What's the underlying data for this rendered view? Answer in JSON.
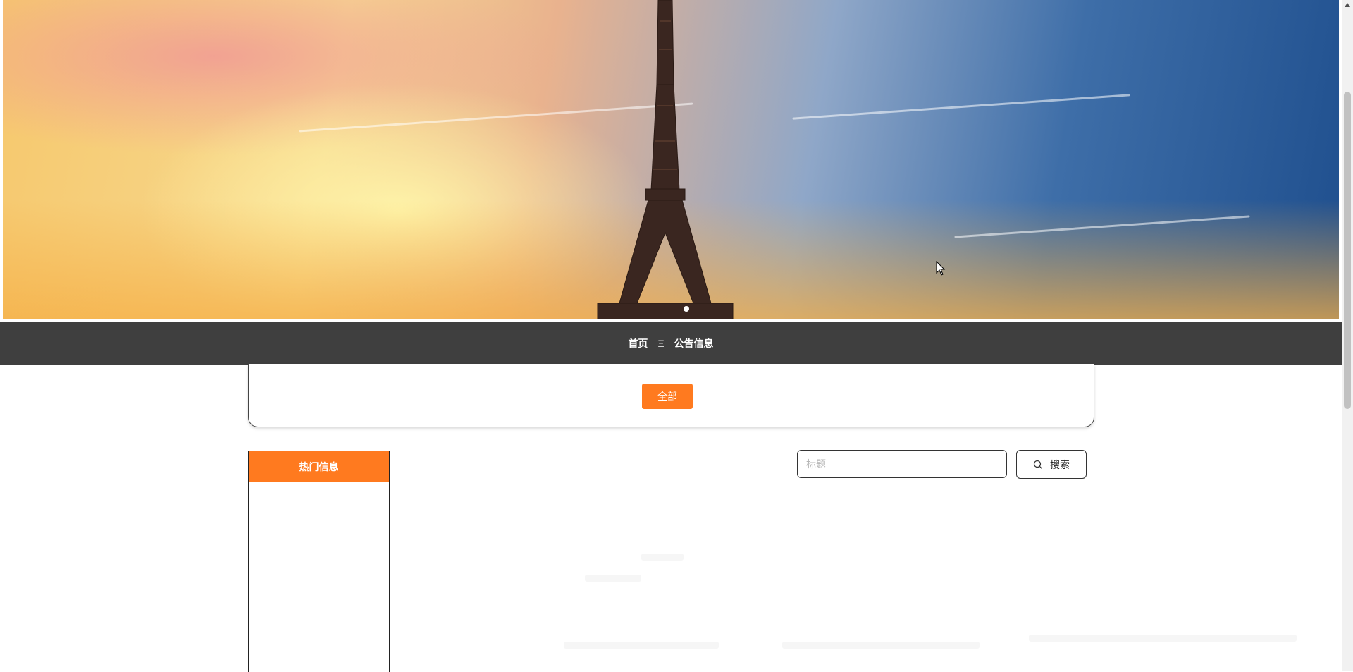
{
  "banner": {
    "slide_indicator_count": 1,
    "active_slide": 1
  },
  "breadcrumb": {
    "home": "首页",
    "separator": "Ξ",
    "current": "公告信息"
  },
  "categories": {
    "all_label": "全部"
  },
  "hot_panel": {
    "title": "热门信息"
  },
  "search": {
    "placeholder": "标题",
    "button_label": "搜索"
  },
  "colors": {
    "accent": "#ff7a1f",
    "navbar": "#3f3f3f"
  }
}
